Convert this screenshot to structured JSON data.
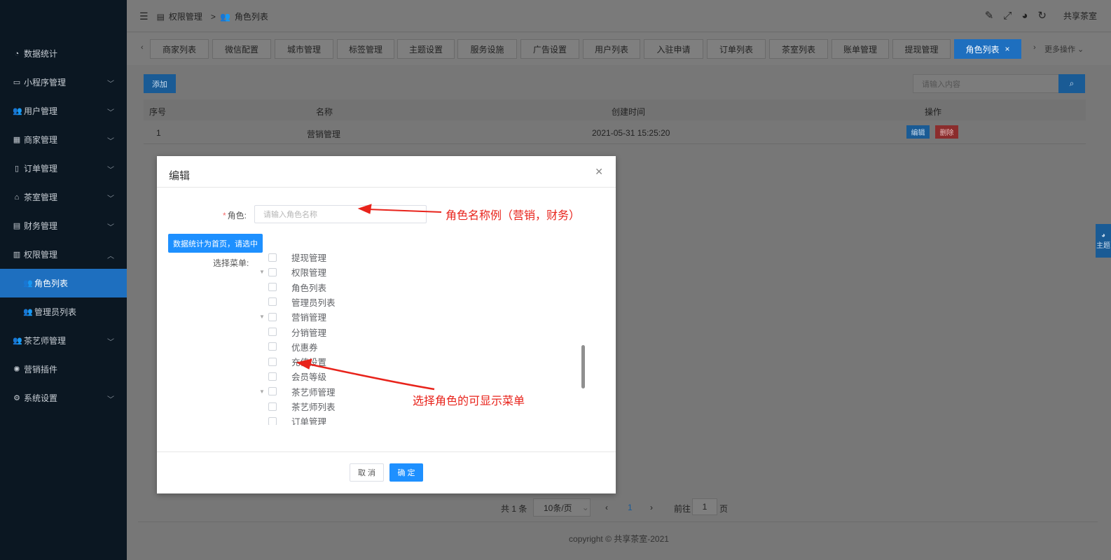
{
  "sidebar": {
    "items": [
      {
        "label": "数据统计",
        "icon": "dashboard-icon",
        "has_children": false
      },
      {
        "label": "小程序管理",
        "icon": "monitor-icon",
        "has_children": true
      },
      {
        "label": "用户管理",
        "icon": "users-icon",
        "has_children": true
      },
      {
        "label": "商家管理",
        "icon": "shop-icon",
        "has_children": true
      },
      {
        "label": "订单管理",
        "icon": "clipboard-icon",
        "has_children": true
      },
      {
        "label": "茶室管理",
        "icon": "home-icon",
        "has_children": true
      },
      {
        "label": "财务管理",
        "icon": "wallet-icon",
        "has_children": true
      },
      {
        "label": "权限管理",
        "icon": "stack-icon",
        "has_children": true,
        "expanded": true
      },
      {
        "label": "角色列表",
        "icon": "user-group-icon",
        "sub": true,
        "active": true
      },
      {
        "label": "管理员列表",
        "icon": "users-icon",
        "sub": true
      },
      {
        "label": "茶艺师管理",
        "icon": "users-icon",
        "has_children": true
      },
      {
        "label": "营销插件",
        "icon": "gear-alt-icon",
        "has_children": false
      },
      {
        "label": "系统设置",
        "icon": "gear-icon",
        "has_children": true
      }
    ]
  },
  "header": {
    "breadcrumb": [
      "权限管理",
      "角色列表"
    ],
    "user": "共享茶室"
  },
  "tabs": [
    "商家列表",
    "微信配置",
    "城市管理",
    "标签管理",
    "主题设置",
    "服务设施",
    "广告设置",
    "用户列表",
    "入驻申请",
    "订单列表",
    "茶室列表",
    "账单管理",
    "提现管理",
    "角色列表"
  ],
  "active_tab_close": "×",
  "more_ops": "更多操作",
  "toolbar": {
    "add_label": "添加",
    "search_placeholder": "请输入内容"
  },
  "table": {
    "columns": [
      "序号",
      "名称",
      "创建时间",
      "操作"
    ],
    "rows": [
      {
        "index": "1",
        "name": "营销管理",
        "created": "2021-05-31 15:25:20",
        "edit": "编辑",
        "delete": "删除"
      }
    ]
  },
  "pagination": {
    "total": "共 1 条",
    "page_size": "10条/页",
    "current_page": "1",
    "goto_label": "前往",
    "goto_value": "1",
    "page_suffix": "页"
  },
  "footer": "copyright © 共享茶室-2021",
  "theme_tab": "主题",
  "modal": {
    "title": "编辑",
    "role_label": "角色:",
    "role_placeholder": "请输入角色名称",
    "info_button": "数据统计为首页，请选中",
    "menu_label": "选择菜单:",
    "tree": [
      {
        "label": "提现管理",
        "level": 2
      },
      {
        "label": "权限管理",
        "level": 1
      },
      {
        "label": "角色列表",
        "level": 2
      },
      {
        "label": "管理员列表",
        "level": 2
      },
      {
        "label": "营销管理",
        "level": 1
      },
      {
        "label": "分销管理",
        "level": 2
      },
      {
        "label": "优惠券",
        "level": 2
      },
      {
        "label": "充值设置",
        "level": 2
      },
      {
        "label": "会员等级",
        "level": 2
      },
      {
        "label": "茶艺师管理",
        "level": 1
      },
      {
        "label": "茶艺师列表",
        "level": 2
      },
      {
        "label": "订单管理",
        "level": 2
      }
    ],
    "cancel_label": "取 消",
    "ok_label": "确 定"
  },
  "annotations": {
    "role_note": "角色名称例（营销，财务）",
    "menu_note": "选择角色的可显示菜单",
    "color": "#e8231b"
  }
}
